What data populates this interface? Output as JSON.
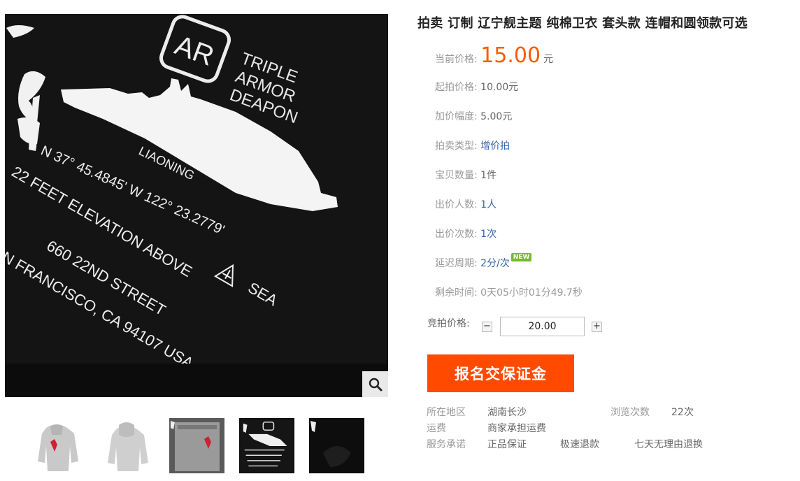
{
  "product": {
    "title": "拍卖 订制 辽宁舰主题 纯棉卫衣 套头款 连帽和圆领款可选"
  },
  "image": {
    "logo_text": "AR",
    "brand_lines": [
      "TRIPLE",
      "ARMOR",
      "DEAPON"
    ],
    "ship_name": "LIAONING",
    "print_lines": [
      "N 37° 45.4845' W 122° 23.2779'",
      "22 FEET ELEVATION ABOVE",
      "SEA",
      "660 22ND STREET",
      "N FRANCISCO, CA 94107 USA"
    ],
    "zoom_icon": "magnifier-icon"
  },
  "thumbnails": [
    {
      "name": "thumbnail-1",
      "style": "grey-hoodie-front"
    },
    {
      "name": "thumbnail-2",
      "style": "grey-hoodie-back"
    },
    {
      "name": "thumbnail-3",
      "style": "grey-sweatshirt-detail"
    },
    {
      "name": "thumbnail-4",
      "style": "black-print-detail",
      "selected": true
    },
    {
      "name": "thumbnail-5",
      "style": "black-fabric"
    }
  ],
  "auction": {
    "current_price_label": "当前价格:",
    "current_price": "15.00",
    "current_price_unit": "元",
    "start_price_label": "起拍价格:",
    "start_price": "10.00元",
    "increment_label": "加价幅度:",
    "increment": "5.00元",
    "type_label": "拍卖类型:",
    "type": "增价拍",
    "quantity_label": "宝贝数量:",
    "quantity": "1件",
    "bidders_label": "出价人数:",
    "bidders": "1人",
    "bids_label": "出价次数:",
    "bids": "1次",
    "delay_label": "延迟周期:",
    "delay": "2分/次",
    "new_badge": "NEW",
    "remaining_label": "剩余时间:",
    "remaining": "0天05小时01分49.7秒",
    "bid_label": "竞拍价格:",
    "bid_value": "20.00",
    "minus": "−",
    "plus": "+",
    "deposit_button": "报名交保证金"
  },
  "info": {
    "location_label": "所在地区",
    "location": "湖南长沙",
    "views_label": "浏览次数",
    "views": "22次",
    "shipping_label": "运费",
    "shipping": "商家承担运费",
    "service_label": "服务承诺",
    "services": [
      "正品保证",
      "极速退款",
      "七天无理由退换"
    ]
  },
  "colors": {
    "price": "#ff5a00",
    "link": "#3363ad",
    "button": "#ff4a00",
    "badge": "#77b92f"
  }
}
